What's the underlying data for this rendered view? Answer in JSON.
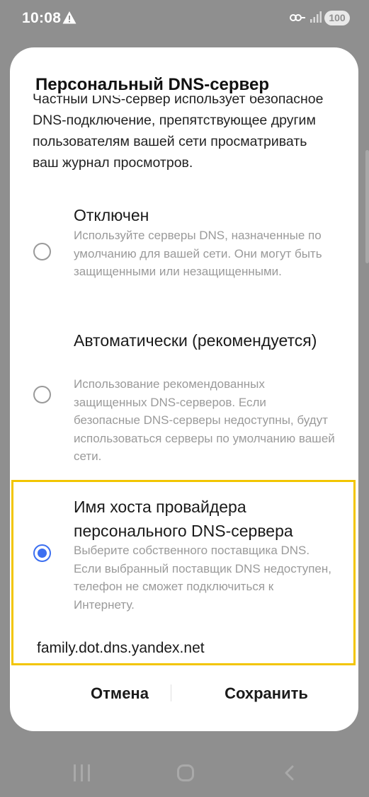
{
  "status_bar": {
    "time": "10:08",
    "battery": "100"
  },
  "dialog": {
    "title": "Персональный DNS-сервер",
    "intro": "Частный DNS-сервер использует безопасное DNS-подключение, препятствующее другим пользователям вашей сети просматривать ваш журнал просмотров.",
    "options": [
      {
        "title": "Отключен",
        "description": "Используйте серверы DNS, назначенные по умолчанию для вашей сети. Они могут быть защищенными или незащищенными.",
        "selected": false
      },
      {
        "title": "Автоматически (рекомендуется)",
        "description": "Использование рекомендованных защищенных DNS-серверов. Если безопасные DNS-серверы недоступны, будут использоваться серверы по умолчанию вашей сети.",
        "selected": false
      },
      {
        "title": "Имя хоста провайдера персонального DNS-сервера",
        "description": "Выберите собственного поставщика DNS. Если выбранный поставщик DNS недоступен, телефон не сможет подключиться к Интернету.",
        "selected": true
      }
    ],
    "hostname_value": "family.dot.dns.yandex.net",
    "cancel_label": "Отмена",
    "save_label": "Сохранить"
  },
  "colors": {
    "accent": "#3c6ff0",
    "highlight": "#f2c500",
    "scrim": "#8f8f8f"
  },
  "icons": [
    "warning-icon",
    "key-icon",
    "signal-icon",
    "recent-apps-icon",
    "home-icon",
    "back-icon"
  ]
}
